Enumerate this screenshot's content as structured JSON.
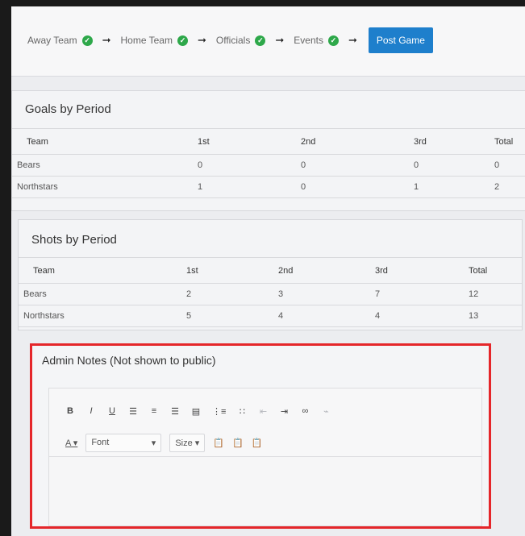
{
  "wizard": {
    "steps": [
      {
        "label": "Away Team"
      },
      {
        "label": "Home Team"
      },
      {
        "label": "Officials"
      },
      {
        "label": "Events"
      }
    ],
    "post_game_label": "Post Game"
  },
  "goals": {
    "title": "Goals by Period",
    "headers": [
      "Team",
      "1st",
      "2nd",
      "3rd",
      "Total"
    ],
    "rows": [
      [
        "Bears",
        "0",
        "0",
        "0",
        "0"
      ],
      [
        "Northstars",
        "1",
        "0",
        "1",
        "2"
      ]
    ]
  },
  "shots": {
    "title": "Shots by Period",
    "headers": [
      "Team",
      "1st",
      "2nd",
      "3rd",
      "Total"
    ],
    "rows": [
      [
        "Bears",
        "2",
        "3",
        "7",
        "12"
      ],
      [
        "Northstars",
        "5",
        "4",
        "4",
        "13"
      ]
    ]
  },
  "admin_notes": {
    "title": "Admin Notes (Not shown to public)",
    "toolbar": {
      "bold": "B",
      "italic": "I",
      "underline": "U",
      "font_select": "Font",
      "size_select": "Size"
    }
  },
  "colors": {
    "accent": "#1e7fcc",
    "check": "#2ea84a",
    "highlight_border": "#e5262a"
  }
}
